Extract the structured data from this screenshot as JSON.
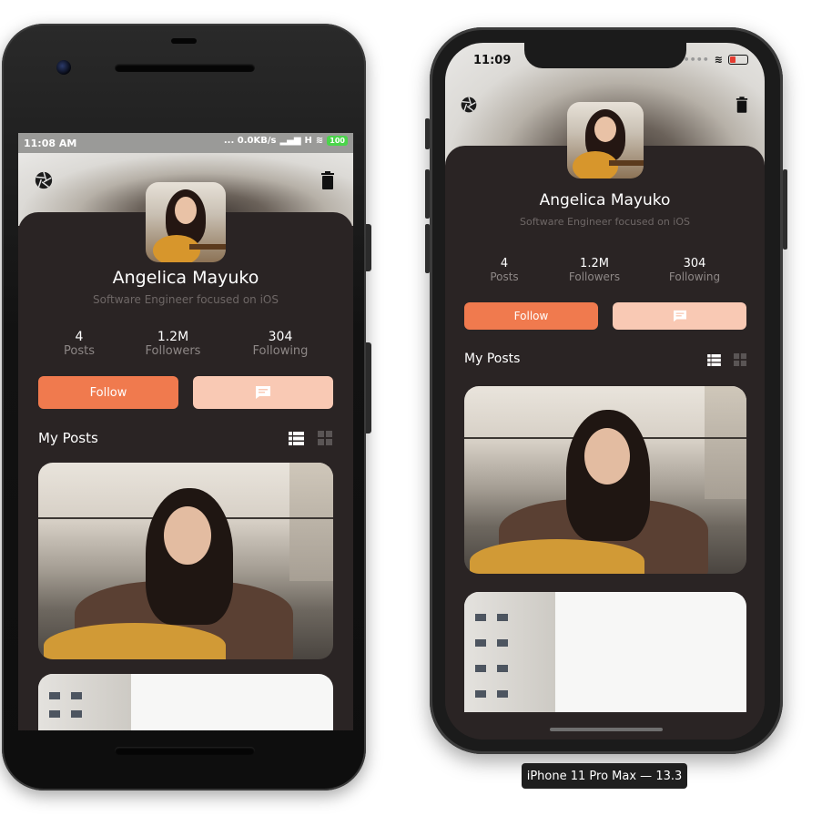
{
  "android": {
    "status": {
      "time": "11:08 AM",
      "speed": "... 0.0KB/s",
      "network": "H",
      "battery": "100"
    },
    "profile": {
      "name": "Angelica Mayuko",
      "bio": "Software Engineer focused on iOS",
      "stats": [
        {
          "num": "4",
          "label": "Posts"
        },
        {
          "num": "1.2M",
          "label": "Followers"
        },
        {
          "num": "304",
          "label": "Following"
        }
      ],
      "follow_label": "Follow",
      "section_title": "My Posts"
    }
  },
  "iphone": {
    "status": {
      "time": "11:09"
    },
    "profile": {
      "name": "Angelica Mayuko",
      "bio": "Software Engineer focused on iOS",
      "stats": [
        {
          "num": "4",
          "label": "Posts"
        },
        {
          "num": "1.2M",
          "label": "Followers"
        },
        {
          "num": "304",
          "label": "Following"
        }
      ],
      "follow_label": "Follow",
      "section_title": "My Posts"
    }
  },
  "caption": "iPhone 11 Pro Max — 13.3",
  "colors": {
    "accent": "#f07a4e",
    "accent_light": "#f9c9b4",
    "sheet": "#2a2424"
  },
  "icons": [
    "aperture-icon",
    "trash-icon",
    "message-icon",
    "list-view-icon",
    "grid-view-icon",
    "wifi-icon",
    "battery-icon",
    "signal-icon"
  ]
}
